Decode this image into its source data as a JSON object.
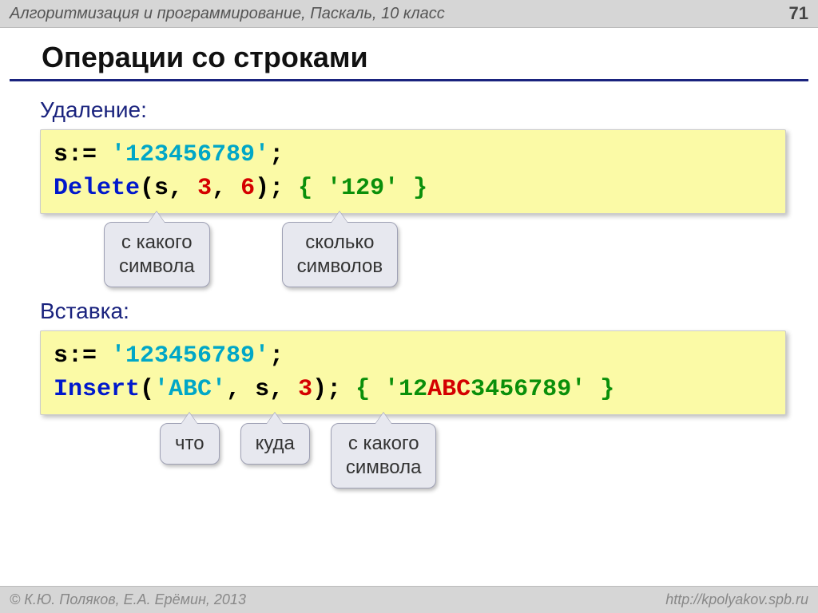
{
  "header": {
    "topic": "Алгоритмизация и программирование, Паскаль, 10 класс",
    "page": "71"
  },
  "title": "Операции со строками",
  "section1": {
    "label": "Удаление:",
    "code": {
      "assign_var": "s:=",
      "literal": " '123456789'",
      "semi1": ";",
      "fn": "Delete",
      "open": "(",
      "arg1": "s,",
      "arg2": " 3",
      "comma2": ",",
      "arg3": " 6",
      "close": ");",
      "comment": " { '129' }"
    },
    "callouts": {
      "c1": "с какого\nсимвола",
      "c2": "сколько\nсимволов"
    }
  },
  "section2": {
    "label": "Вставка:",
    "code": {
      "assign_var": "s:=",
      "literal": " '123456789'",
      "semi1": ";",
      "fn": "Insert",
      "open": "(",
      "arg1": "'ABC'",
      "comma1": ",",
      "arg2": " s,",
      "arg3": " 3",
      "close": ");",
      "comment_open": " { '",
      "comment_a": "12",
      "comment_b": "ABC",
      "comment_c": "3456789",
      "comment_close": "' }"
    },
    "callouts": {
      "c1": "что",
      "c2": "куда",
      "c3": "с какого\nсимвола"
    }
  },
  "footer": {
    "left": "© К.Ю. Поляков, Е.А. Ерёмин, 2013",
    "right": "http://kpolyakov.spb.ru"
  }
}
